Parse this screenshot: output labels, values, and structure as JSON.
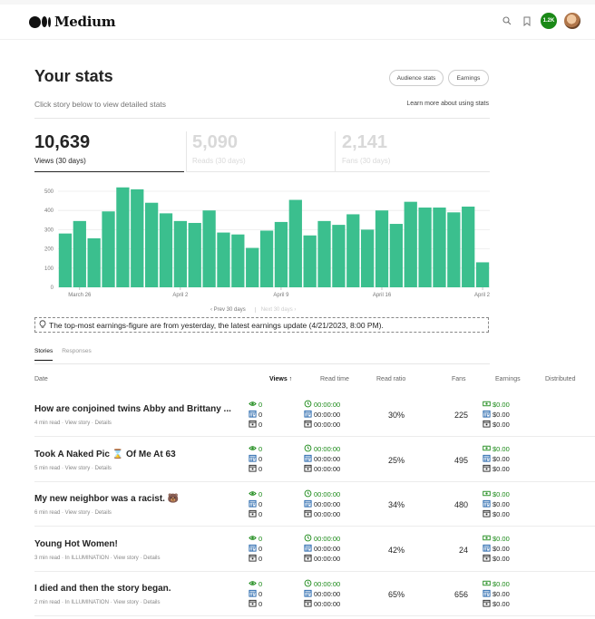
{
  "header": {
    "logo_text": "Medium",
    "notification_count": "1.2K"
  },
  "page": {
    "title": "Your stats",
    "audience_stats_label": "Audience stats",
    "earnings_label": "Earnings",
    "subtitle": "Click story below to view detailed stats",
    "learn_more": "Learn more about using stats"
  },
  "metrics": [
    {
      "value": "10,639",
      "label": "Views (30 days)"
    },
    {
      "value": "5,090",
      "label": "Reads (30 days)"
    },
    {
      "value": "2,141",
      "label": "Fans (30 days)"
    }
  ],
  "chart_data": {
    "type": "bar",
    "title": "",
    "xlabel": "",
    "ylabel": "",
    "ylim": [
      0,
      500
    ],
    "yticks": [
      0,
      100,
      200,
      300,
      400,
      500
    ],
    "xtick_labels": [
      "March 26",
      "April 2",
      "April 9",
      "April 16",
      "April 2"
    ],
    "bar_color": "#3bbf8e",
    "grid": true,
    "values": [
      280,
      345,
      255,
      395,
      520,
      510,
      440,
      385,
      345,
      335,
      400,
      285,
      275,
      205,
      295,
      340,
      455,
      270,
      345,
      325,
      380,
      300,
      400,
      330,
      445,
      415,
      415,
      390,
      420,
      130
    ]
  },
  "pager": {
    "prev": "Prev 30 days",
    "next": "Next 30 days"
  },
  "notice": "The top-most earnings-figure are from yesterday, the latest earnings update (4/21/2023, 8:00 PM).",
  "tabs": [
    "Stories",
    "Responses"
  ],
  "table": {
    "headers": {
      "date": "Date",
      "views": "Views",
      "read_time": "Read time",
      "read_ratio": "Read ratio",
      "fans": "Fans",
      "earnings": "Earnings",
      "distributed": "Distributed"
    },
    "rows": [
      {
        "title": "How are conjoined twins Abby and Brittany ...",
        "meta": "4 min read · View story · Details",
        "views": [
          "0",
          "0",
          "0"
        ],
        "times": [
          "00:00:00",
          "00:00:00",
          "00:00:00"
        ],
        "ratio": "30%",
        "fans": "225",
        "earnings": [
          "$0.00",
          "$0.00",
          "$0.00"
        ]
      },
      {
        "title": "Took A Naked Pic ⌛ Of Me At 63",
        "meta": "5 min read · View story · Details",
        "views": [
          "0",
          "0",
          "0"
        ],
        "times": [
          "00:00:00",
          "00:00:00",
          "00:00:00"
        ],
        "ratio": "25%",
        "fans": "495",
        "earnings": [
          "$0.00",
          "$0.00",
          "$0.00"
        ]
      },
      {
        "title": "My new neighbor was a racist. 🐻",
        "meta": "6 min read · View story · Details",
        "views": [
          "0",
          "0",
          "0"
        ],
        "times": [
          "00:00:00",
          "00:00:00",
          "00:00:00"
        ],
        "ratio": "34%",
        "fans": "480",
        "earnings": [
          "$0.00",
          "$0.00",
          "$0.00"
        ]
      },
      {
        "title": "Young Hot Women!",
        "meta": "3 min read · In ILLUMINATION · View story · Details",
        "views": [
          "0",
          "0",
          "0"
        ],
        "times": [
          "00:00:00",
          "00:00:00",
          "00:00:00"
        ],
        "ratio": "42%",
        "fans": "24",
        "earnings": [
          "$0.00",
          "$0.00",
          "$0.00"
        ]
      },
      {
        "title": "I died and then the story began.",
        "meta": "2 min read · In ILLUMINATION · View story · Details",
        "views": [
          "0",
          "0",
          "0"
        ],
        "times": [
          "00:00:00",
          "00:00:00",
          "00:00:00"
        ],
        "ratio": "65%",
        "fans": "656",
        "earnings": [
          "$0.00",
          "$0.00",
          "$0.00"
        ]
      }
    ]
  }
}
